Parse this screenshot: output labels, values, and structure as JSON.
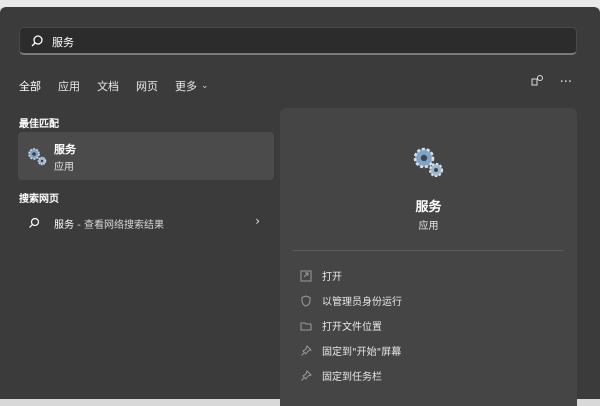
{
  "search": {
    "value": "服务"
  },
  "tabs": [
    {
      "label": "全部"
    },
    {
      "label": "应用"
    },
    {
      "label": "文档"
    },
    {
      "label": "网页"
    },
    {
      "label": "更多"
    }
  ],
  "best_match": {
    "section_label": "最佳匹配",
    "name": "服务",
    "type": "应用"
  },
  "web": {
    "section_label": "搜索网页",
    "query": "服务",
    "suffix": " - 查看网络搜索结果"
  },
  "detail": {
    "title": "服务",
    "type": "应用",
    "actions": [
      {
        "label": "打开",
        "icon": "open-icon"
      },
      {
        "label": "以管理员身份运行",
        "icon": "shield-icon"
      },
      {
        "label": "打开文件位置",
        "icon": "folder-icon"
      },
      {
        "label": "固定到\"开始\"屏幕",
        "icon": "pin-icon"
      },
      {
        "label": "固定到任务栏",
        "icon": "pin-icon"
      }
    ]
  },
  "colors": {
    "panel": "#3b3b3b",
    "detail": "#454545",
    "highlight": "#4b4b4b",
    "gear": "#7fa4c9"
  }
}
